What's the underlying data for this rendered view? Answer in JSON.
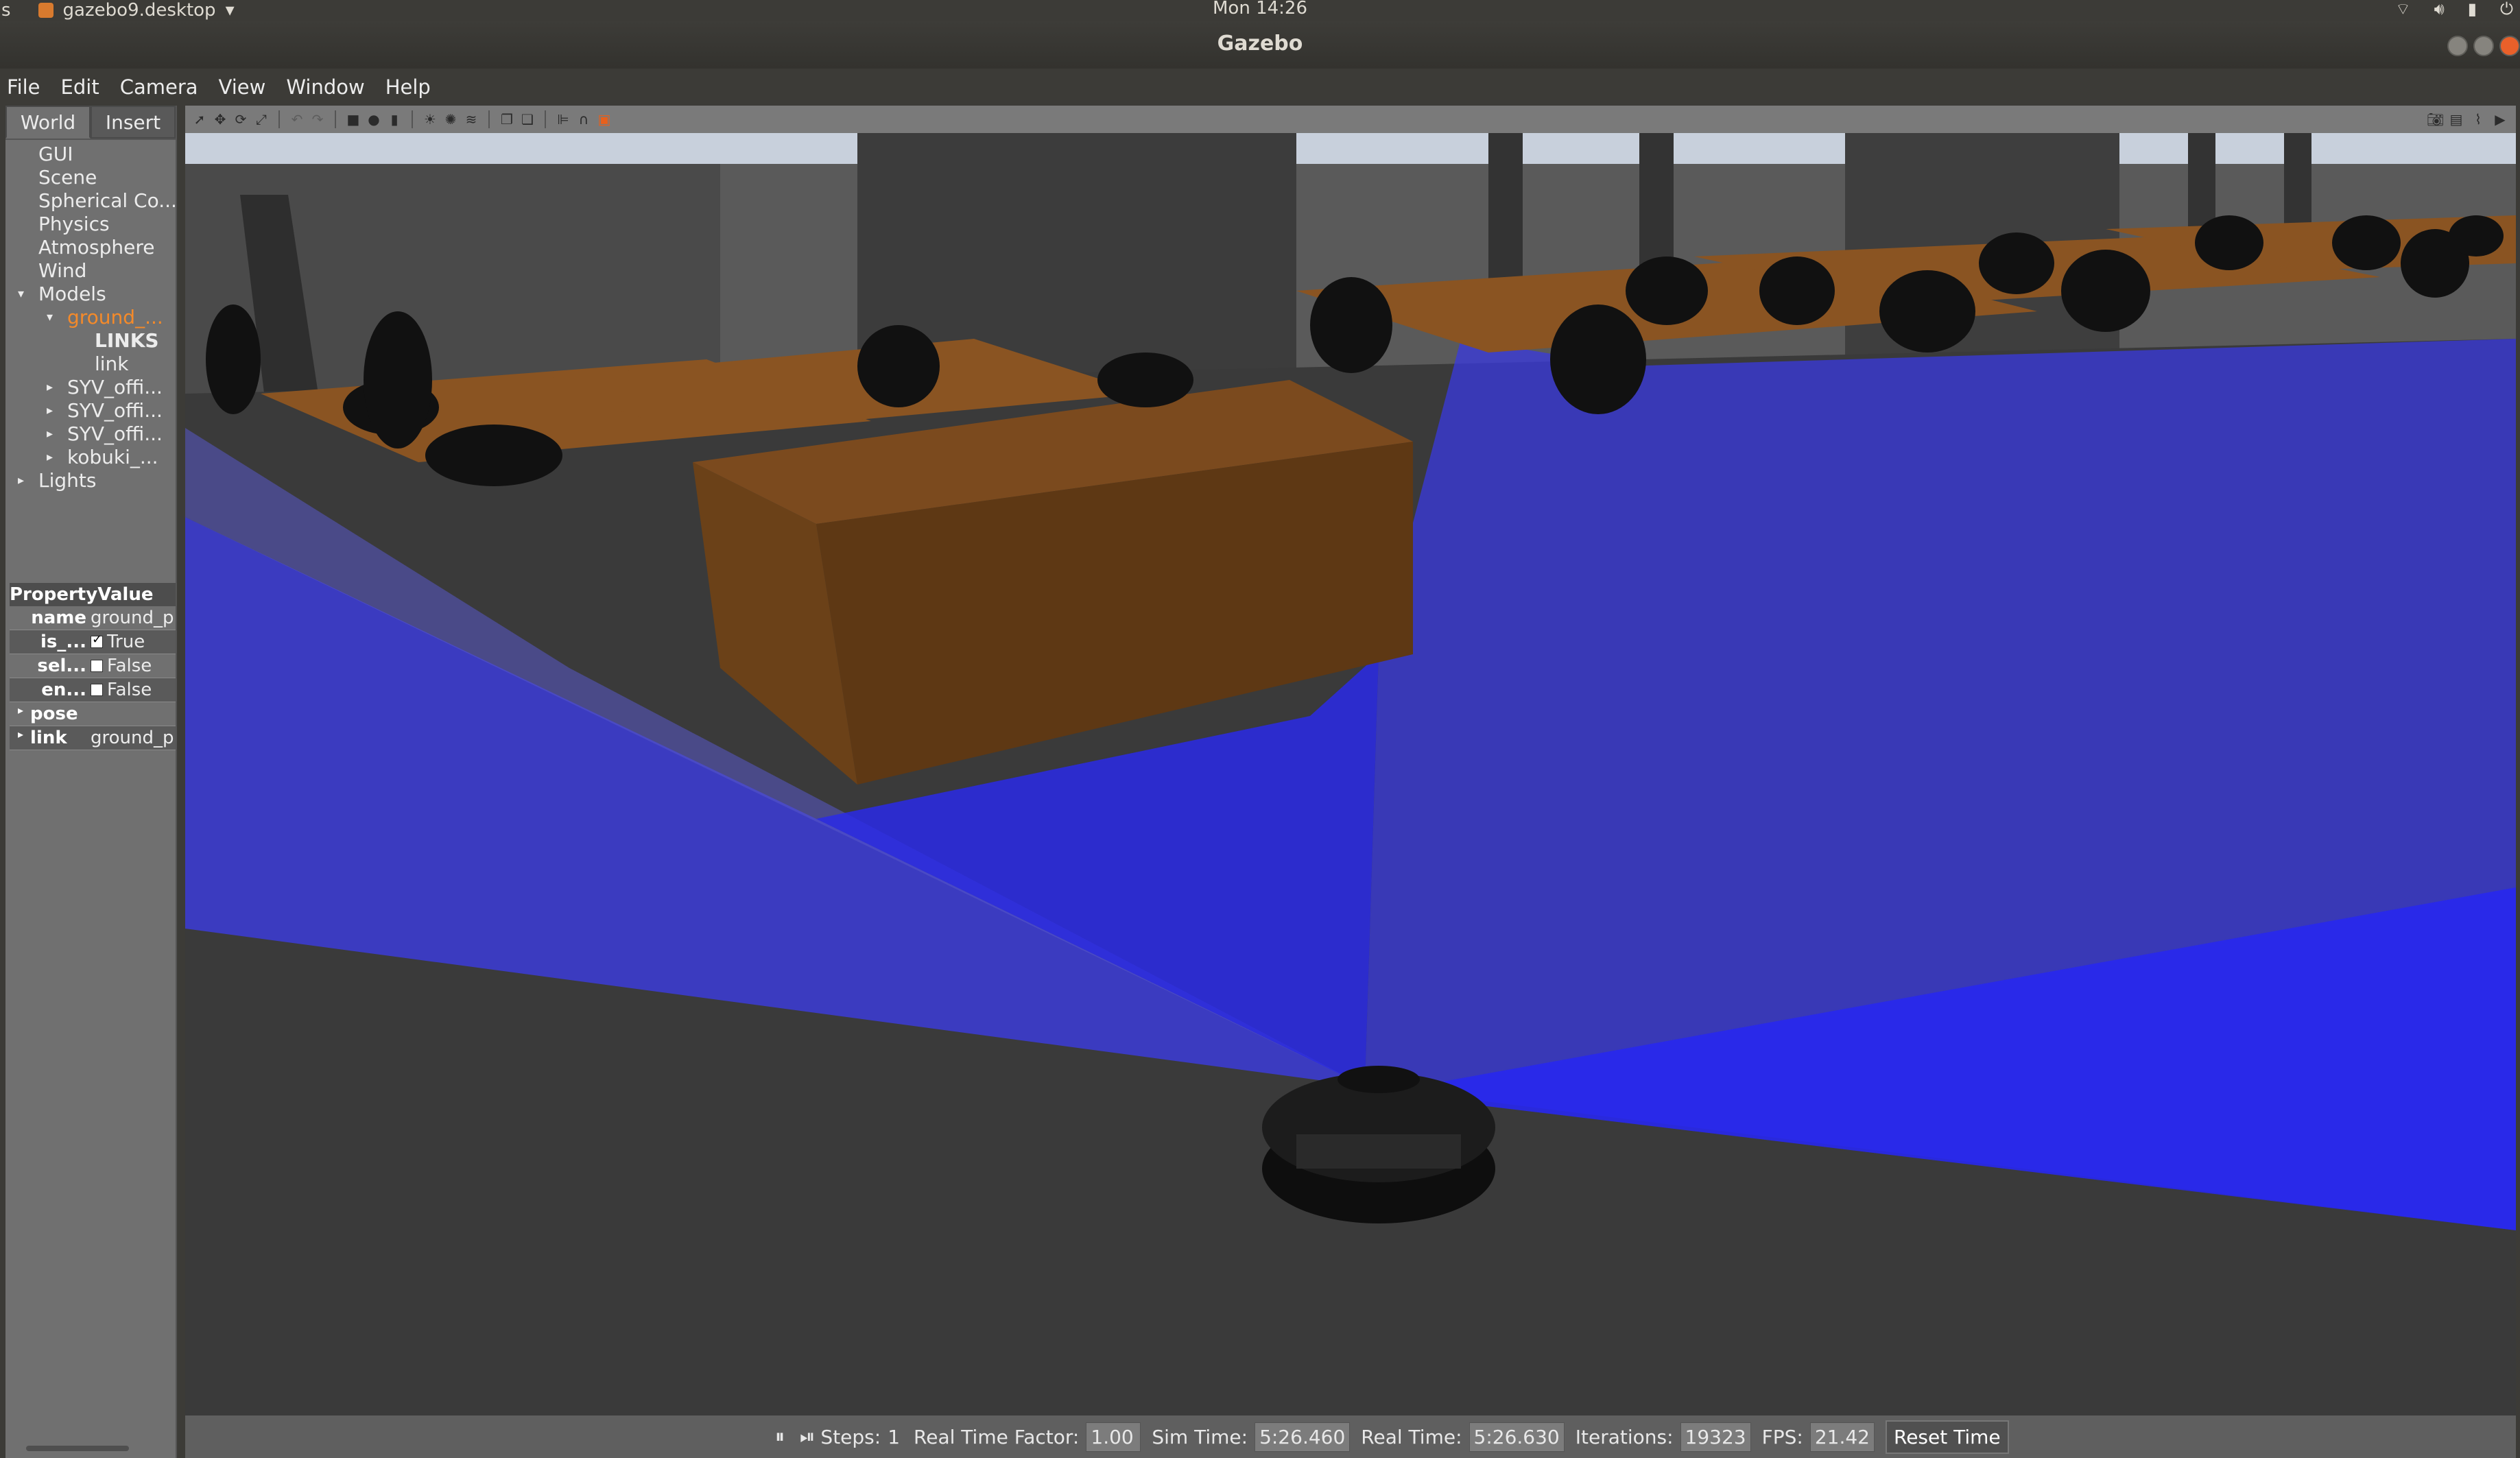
{
  "top_panel": {
    "left_label": "s",
    "app_name": "gazebo9.desktop",
    "app_dropdown": "▾",
    "clock": "Mon 14:26"
  },
  "window": {
    "title": "Gazebo"
  },
  "menu": {
    "items": [
      "File",
      "Edit",
      "Camera",
      "View",
      "Window",
      "Help"
    ]
  },
  "left_panel": {
    "tabs": [
      "World",
      "Insert"
    ],
    "tree": [
      {
        "label": "GUI",
        "indent": 0,
        "arrow": ""
      },
      {
        "label": "Scene",
        "indent": 0,
        "arrow": ""
      },
      {
        "label": "Spherical Co...",
        "indent": 0,
        "arrow": ""
      },
      {
        "label": "Physics",
        "indent": 0,
        "arrow": ""
      },
      {
        "label": "Atmosphere",
        "indent": 0,
        "arrow": ""
      },
      {
        "label": "Wind",
        "indent": 0,
        "arrow": ""
      },
      {
        "label": "Models",
        "indent": 0,
        "arrow": "▾"
      },
      {
        "label": "ground_...",
        "indent": 1,
        "arrow": "▾"
      },
      {
        "label": "LINKS",
        "indent": 2,
        "arrow": ""
      },
      {
        "label": "link",
        "indent": 2,
        "arrow": ""
      },
      {
        "label": "SYV_offi...",
        "indent": 1,
        "arrow": "▸"
      },
      {
        "label": "SYV_offi...",
        "indent": 1,
        "arrow": "▸"
      },
      {
        "label": "SYV_offi...",
        "indent": 1,
        "arrow": "▸"
      },
      {
        "label": "kobuki_...",
        "indent": 1,
        "arrow": "▸"
      },
      {
        "label": "Lights",
        "indent": 0,
        "arrow": "▸"
      }
    ],
    "properties": {
      "header_property": "Property",
      "header_value": "Value",
      "rows": {
        "name": {
          "key": "name",
          "value": "ground_p"
        },
        "is_static": {
          "key": "is_...",
          "value": "True"
        },
        "self_collide": {
          "key": "sel...",
          "value": "False"
        },
        "enable_wind": {
          "key": "en...",
          "value": "False"
        },
        "pose": {
          "key": "pose",
          "value": ""
        },
        "link": {
          "key": "link",
          "value": "ground_p"
        }
      }
    }
  },
  "status_bar": {
    "steps_label": "Steps:",
    "steps_value": "1",
    "rtf_label": "Real Time Factor:",
    "rtf_value": "1.00",
    "sim_time_label": "Sim Time:",
    "sim_time_value": "5:26.460",
    "real_time_label": "Real Time:",
    "real_time_value": "5:26.630",
    "iterations_label": "Iterations:",
    "iterations_value": "19323",
    "fps_label": "FPS:",
    "fps_value": "21.42",
    "reset_label": "Reset Time"
  },
  "colors": {
    "selected_tree": "#f48a2a",
    "laser": "#2a2ae8",
    "furniture": "#7a4a1c"
  }
}
